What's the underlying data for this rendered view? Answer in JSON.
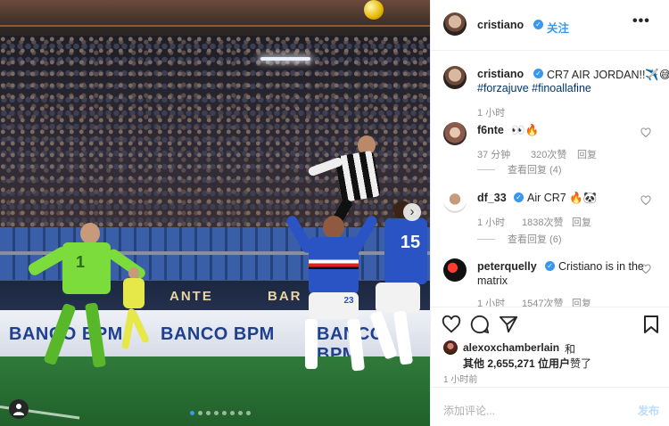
{
  "post": {
    "author": "cristiano",
    "follow_label": "关注",
    "more_label": "•••",
    "caption_user": "cristiano",
    "caption_text": "CR7 AIR JORDAN!!✈️😅",
    "caption_tags": "#forzajuve #finoallafine",
    "caption_time": "1 小时"
  },
  "photo": {
    "ad_top": [
      "ANTE",
      "BAR"
    ],
    "ad_bottom": [
      "BANCO BPM",
      "BANCO BPM",
      "BANCO BPM"
    ],
    "player_numbers": [
      "1",
      "23",
      "15"
    ]
  },
  "comments": [
    {
      "user": "f6nte",
      "verified": false,
      "text": "👀🔥",
      "time": "37 分钟",
      "likes": "320次赞",
      "reply": "回复",
      "view_replies": "查看回复 (4)"
    },
    {
      "user": "df_33",
      "verified": true,
      "text": "Air CR7 🔥🐼",
      "time": "1 小时",
      "likes": "1838次赞",
      "reply": "回复",
      "view_replies": "查看回复 (6)"
    },
    {
      "user": "peterquelly",
      "verified": true,
      "text": "Cristiano is in the",
      "text2": "matrix",
      "time": "1 小时",
      "likes": "1547次赞",
      "reply": "回复"
    }
  ],
  "liked_by": {
    "user": "alexoxchamberlain",
    "and": "和",
    "others": "其他 2,655,271 位用户",
    "liked": "赞了"
  },
  "post_time": "1 小时前",
  "comment_placeholder": "添加评论...",
  "post_button": "发布",
  "colors": {
    "accent": "#3897f0",
    "text": "#262626",
    "muted": "#8e8e8e"
  }
}
